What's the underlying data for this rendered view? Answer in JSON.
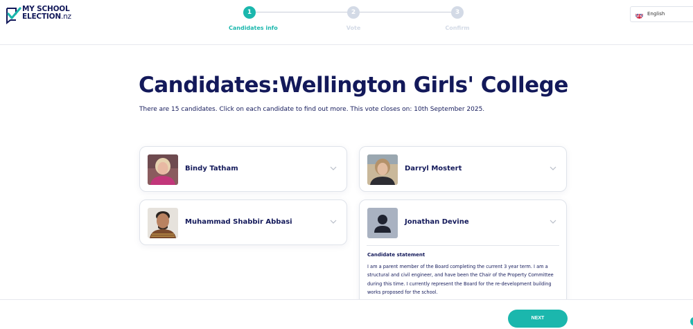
{
  "brand": {
    "line1": "MY SCHOOL",
    "line2": "ELECTION",
    "suffix": ".nz",
    "accent": "#1bb7ad",
    "navy": "#13195a"
  },
  "stepper": [
    {
      "number": "1",
      "label": "Candidates info",
      "state": "active"
    },
    {
      "number": "2",
      "label": "Vote",
      "state": "pending"
    },
    {
      "number": "3",
      "label": "Confirm",
      "state": "pending"
    }
  ],
  "language": {
    "label": "English",
    "icon": "uk-flag-icon"
  },
  "page": {
    "title": "Candidates:Wellington Girls' College",
    "subtitle": "There are 15 candidates. Click on each candidate to find out more. This vote closes on:  10th September 2025."
  },
  "candidates": [
    {
      "name": "Bindy Tatham",
      "expanded": false
    },
    {
      "name": "Darryl Mostert",
      "expanded": false
    },
    {
      "name": "Muhammad Shabbir Abbasi",
      "expanded": false
    },
    {
      "name": "Jonathan Devine",
      "expanded": true,
      "photo": "placeholder-avatar",
      "statement_title": "Candidate statement",
      "statement": "I am a parent member of the Board completing the current 3 year term. I am a structural and civil engineer, and have been the Chair of the Property Committee during this time. I currently represent the Board for the re-development building works proposed for the school."
    }
  ],
  "footer": {
    "next_label": "NEXT"
  }
}
